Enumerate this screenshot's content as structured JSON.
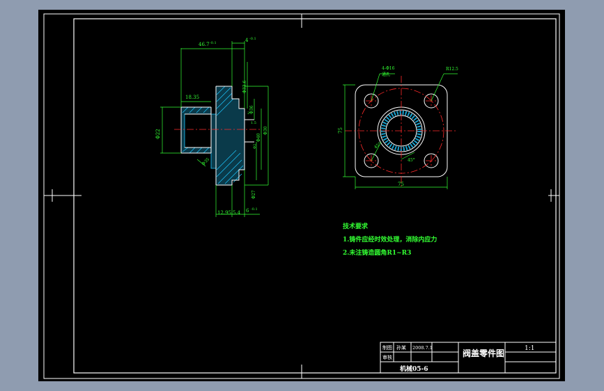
{
  "drawing": {
    "colors": {
      "background": "#000000",
      "border": "#ffffff",
      "geometry": "#ffffff",
      "dimension": "#33ff33",
      "center_line": "#ff2a2a",
      "hatch": "#1ec8ff",
      "outside": "#8f9cb0"
    },
    "front_view": {
      "dims": {
        "top_overall": "46.7",
        "top_overall_tol": "-0.1",
        "top_step": "4",
        "top_step_tol": "-0.1",
        "left_len": "18.35",
        "left_dia": "Φ22",
        "right_dia": "Φ35",
        "bot_a": "12.95",
        "bot_b": "5.4",
        "bot_c": "6",
        "bot_c_tol": "-0.1",
        "vert_1": "Φ33.6",
        "vert_2": "Φ36",
        "vert_3": "Φ40",
        "vert_4": "Φ30",
        "vert_5": "Φ27",
        "small_1": "2",
        "small_2": "1.5",
        "small_3": "Φ2"
      }
    },
    "side_view": {
      "label_holes": "4-Φ16",
      "label_holes_2": "通孔",
      "label_radius": "R12.5",
      "label_angle_1": "45°",
      "label_angle_2": "45°",
      "dim_width": "75",
      "dim_height": "75"
    },
    "notes": {
      "title": "技术要求",
      "items": [
        "1.铸件应经时效处理，消除内应力",
        "2.未注铸造圆角R1~R3"
      ]
    },
    "title_block": {
      "drawn_label": "制图",
      "drawn_name": "孙某",
      "drawn_date": "2008.7.1",
      "review_label": "审核",
      "part_name": "阀盖零件图",
      "scale": "1:1",
      "drawing_no": "机械05-6"
    }
  }
}
